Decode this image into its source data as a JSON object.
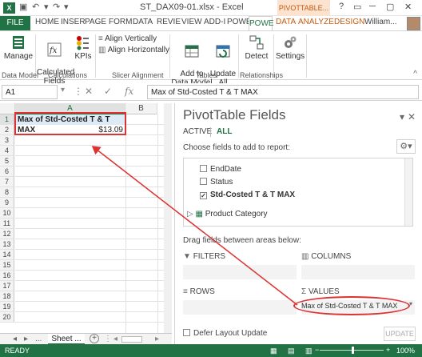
{
  "window": {
    "title": "ST_DAX09-01.xlsx - Excel",
    "app_icon": "X",
    "context_tab": "PIVOTTABLE...",
    "help": "?",
    "user": "William...",
    "controls": [
      "?",
      "▭",
      "─",
      "▢",
      "✕"
    ]
  },
  "tabs": [
    "FILE",
    "HOME",
    "INSER",
    "PAGE",
    "FORM",
    "DATA",
    "REVIE",
    "VIEW",
    "ADD-I",
    "POWE",
    "POWE",
    "DATA",
    "ANALYZE",
    "DESIGN"
  ],
  "ribbon": {
    "manage": "Manage",
    "calculated_fields": "Calculated\nFields",
    "kpis": "KPIs",
    "align_vertically": "Align Vertically",
    "align_horizontally": "Align Horizontally",
    "add_to_data_model": "Add to\nData Model",
    "update_all": "Update\nAll",
    "detect": "Detect",
    "settings": "Settings",
    "groups": [
      "Data Model",
      "Calculations",
      "Slicer Alignment",
      "Tables",
      "Relationships"
    ]
  },
  "formula_bar": {
    "name_box": "A1",
    "fx": "fx",
    "formula": "Max of Std-Costed T & T MAX"
  },
  "grid": {
    "columns": [
      "A",
      "B"
    ],
    "rows": [
      "1",
      "2",
      "3",
      "4",
      "5",
      "6",
      "7",
      "8",
      "9",
      "10",
      "11",
      "12",
      "13",
      "14",
      "15",
      "16",
      "17",
      "18",
      "19",
      "20"
    ],
    "a1": "Max of Std-Costed T & T MAX",
    "a2": "$13.09"
  },
  "sheet": {
    "tab": "Sheet ...",
    "add": "+",
    "nav": [
      "◂",
      "▸",
      "..."
    ]
  },
  "pivot": {
    "title": "PivotTable Fields",
    "tab_active": "ACTIVE",
    "tab_all": "ALL",
    "subtitle": "Choose fields to add to report:",
    "fields": [
      {
        "label": "EndDate",
        "checked": false
      },
      {
        "label": "Status",
        "checked": false
      },
      {
        "label": "Std-Costed T & T MAX",
        "checked": true
      }
    ],
    "table": "Product Category",
    "drag_label": "Drag fields between areas below:",
    "filters": "FILTERS",
    "columns": "COLUMNS",
    "rows": "ROWS",
    "values": "VALUES",
    "values_item": "Max of Std-Costed T & T MAX",
    "defer": "Defer Layout Update",
    "update": "UPDATE"
  },
  "status": {
    "ready": "READY",
    "zoom": "100%"
  },
  "colors": {
    "accent": "#217346",
    "annotation": "#dd3333"
  }
}
